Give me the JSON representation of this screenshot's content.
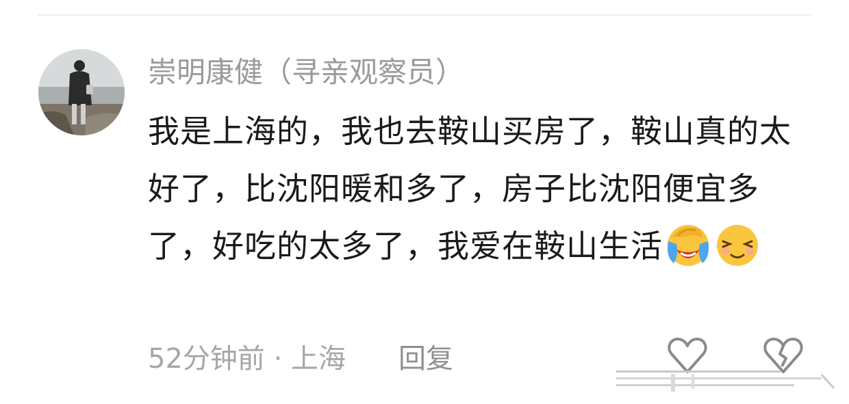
{
  "comment": {
    "username": "崇明康健（寻亲观察员）",
    "text": "我是上海的，我也去鞍山买房了，鞍山真的太好了，比沈阳暖和多了，房子比沈阳便宜多了，好吃的太多了，我爱在鞍山生活",
    "emojis": [
      "facepalm-crying-emoji",
      "relieved-smile-emoji"
    ],
    "time_location": "52分钟前 · 上海",
    "reply_label": "回复"
  },
  "icons": {
    "like": "heart-outline-icon",
    "dislike": "broken-heart-icon"
  },
  "colors": {
    "username": "#9a9a9a",
    "text": "#1a1a1a",
    "meta": "#a6a6a6",
    "divider": "#eeeeee",
    "icon": "#8a8a8a"
  }
}
